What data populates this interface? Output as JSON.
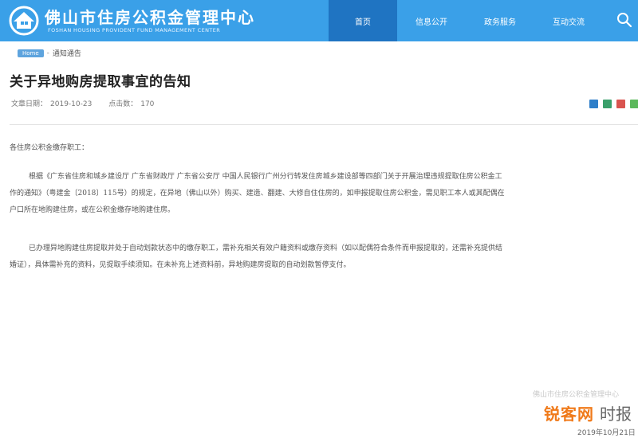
{
  "header": {
    "site_title": "佛山市住房公积金管理中心",
    "site_subtitle": "FOSHAN HOUSING PROVIDENT FUND MANAGEMENT CENTER",
    "bg_color": "#3aa0e8",
    "active_color": "#1f74c2",
    "nav": {
      "home": "首页",
      "info": "信息公开",
      "gov_service": "政务服务",
      "interaction": "互动交流"
    },
    "search_icon": "search-icon"
  },
  "breadcrumb": {
    "home": "Home",
    "separator": "-",
    "current": "通知通告"
  },
  "article": {
    "title": "关于异地购房提取事宜的告知",
    "date_label": "文章日期：",
    "date": "2019-10-23",
    "clicks_label": "点击数：",
    "clicks": "170",
    "greeting": "各住房公积金缴存职工：",
    "p1_line1": "根据《广东省住房和城乡建设厅 广东省财政厅 广东省公安厅 中国人民银行广州分行转发住房城乡建设部等四部门关于开展治理违规提取住房公积金工",
    "p1_line2": "作的通知》（粤建金〔2018〕115号）的规定，在异地（佛山以外）购买、建造、翻建、大修自住住房的，如申报提取住房公积金，需见职工本人或其配偶在",
    "p1_line3": "户口所在地购建住房，或在公积金缴存地购建住房。",
    "p2_line1": "已办理异地购建住房提取并处于自动划款状态中的缴存职工，需补充相关有效户籍资料或缴存资料（如以配偶符合条件而申报提取的，还需补充提供结",
    "p2_line2": "婚证），具体需补充的资料，见提取手续须知。在未补充上述资料前，异地购建房提取的自动划款暂停支付。"
  },
  "share_icons": [
    "share-icon",
    "wechat-icon",
    "weibo-icon",
    "qq-icon"
  ],
  "watermark": {
    "stamp": "佛山市住房公积金管理中心",
    "brand": "锐客网",
    "time_text": "时报",
    "date": "2019年10月21日"
  }
}
